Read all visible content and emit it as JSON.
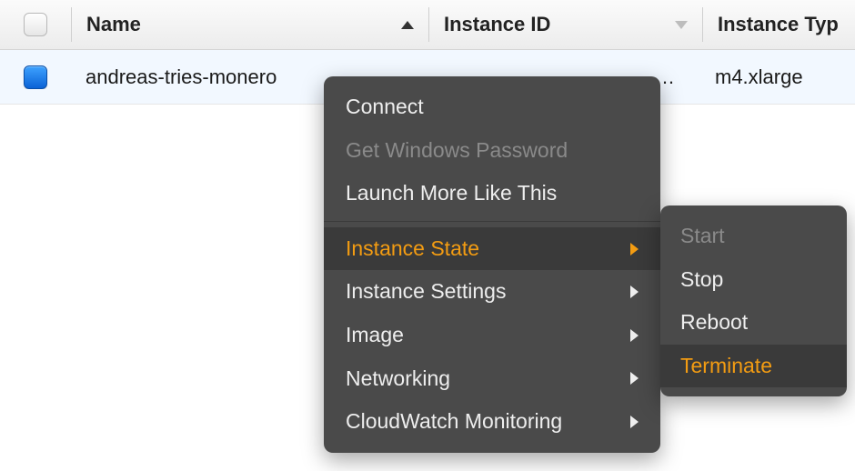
{
  "columns": {
    "name": "Name",
    "instance_id": "Instance ID",
    "instance_type": "Instance Typ"
  },
  "row": {
    "name": "andreas-tries-monero",
    "instance_id_trunc": "…",
    "instance_type": "m4.xlarge",
    "selected": true
  },
  "context_menu": {
    "connect": "Connect",
    "get_windows_password": "Get Windows Password",
    "launch_more": "Launch More Like This",
    "instance_state": "Instance State",
    "instance_settings": "Instance Settings",
    "image": "Image",
    "networking": "Networking",
    "cloudwatch": "CloudWatch Monitoring"
  },
  "instance_state_submenu": {
    "start": "Start",
    "stop": "Stop",
    "reboot": "Reboot",
    "terminate": "Terminate"
  }
}
